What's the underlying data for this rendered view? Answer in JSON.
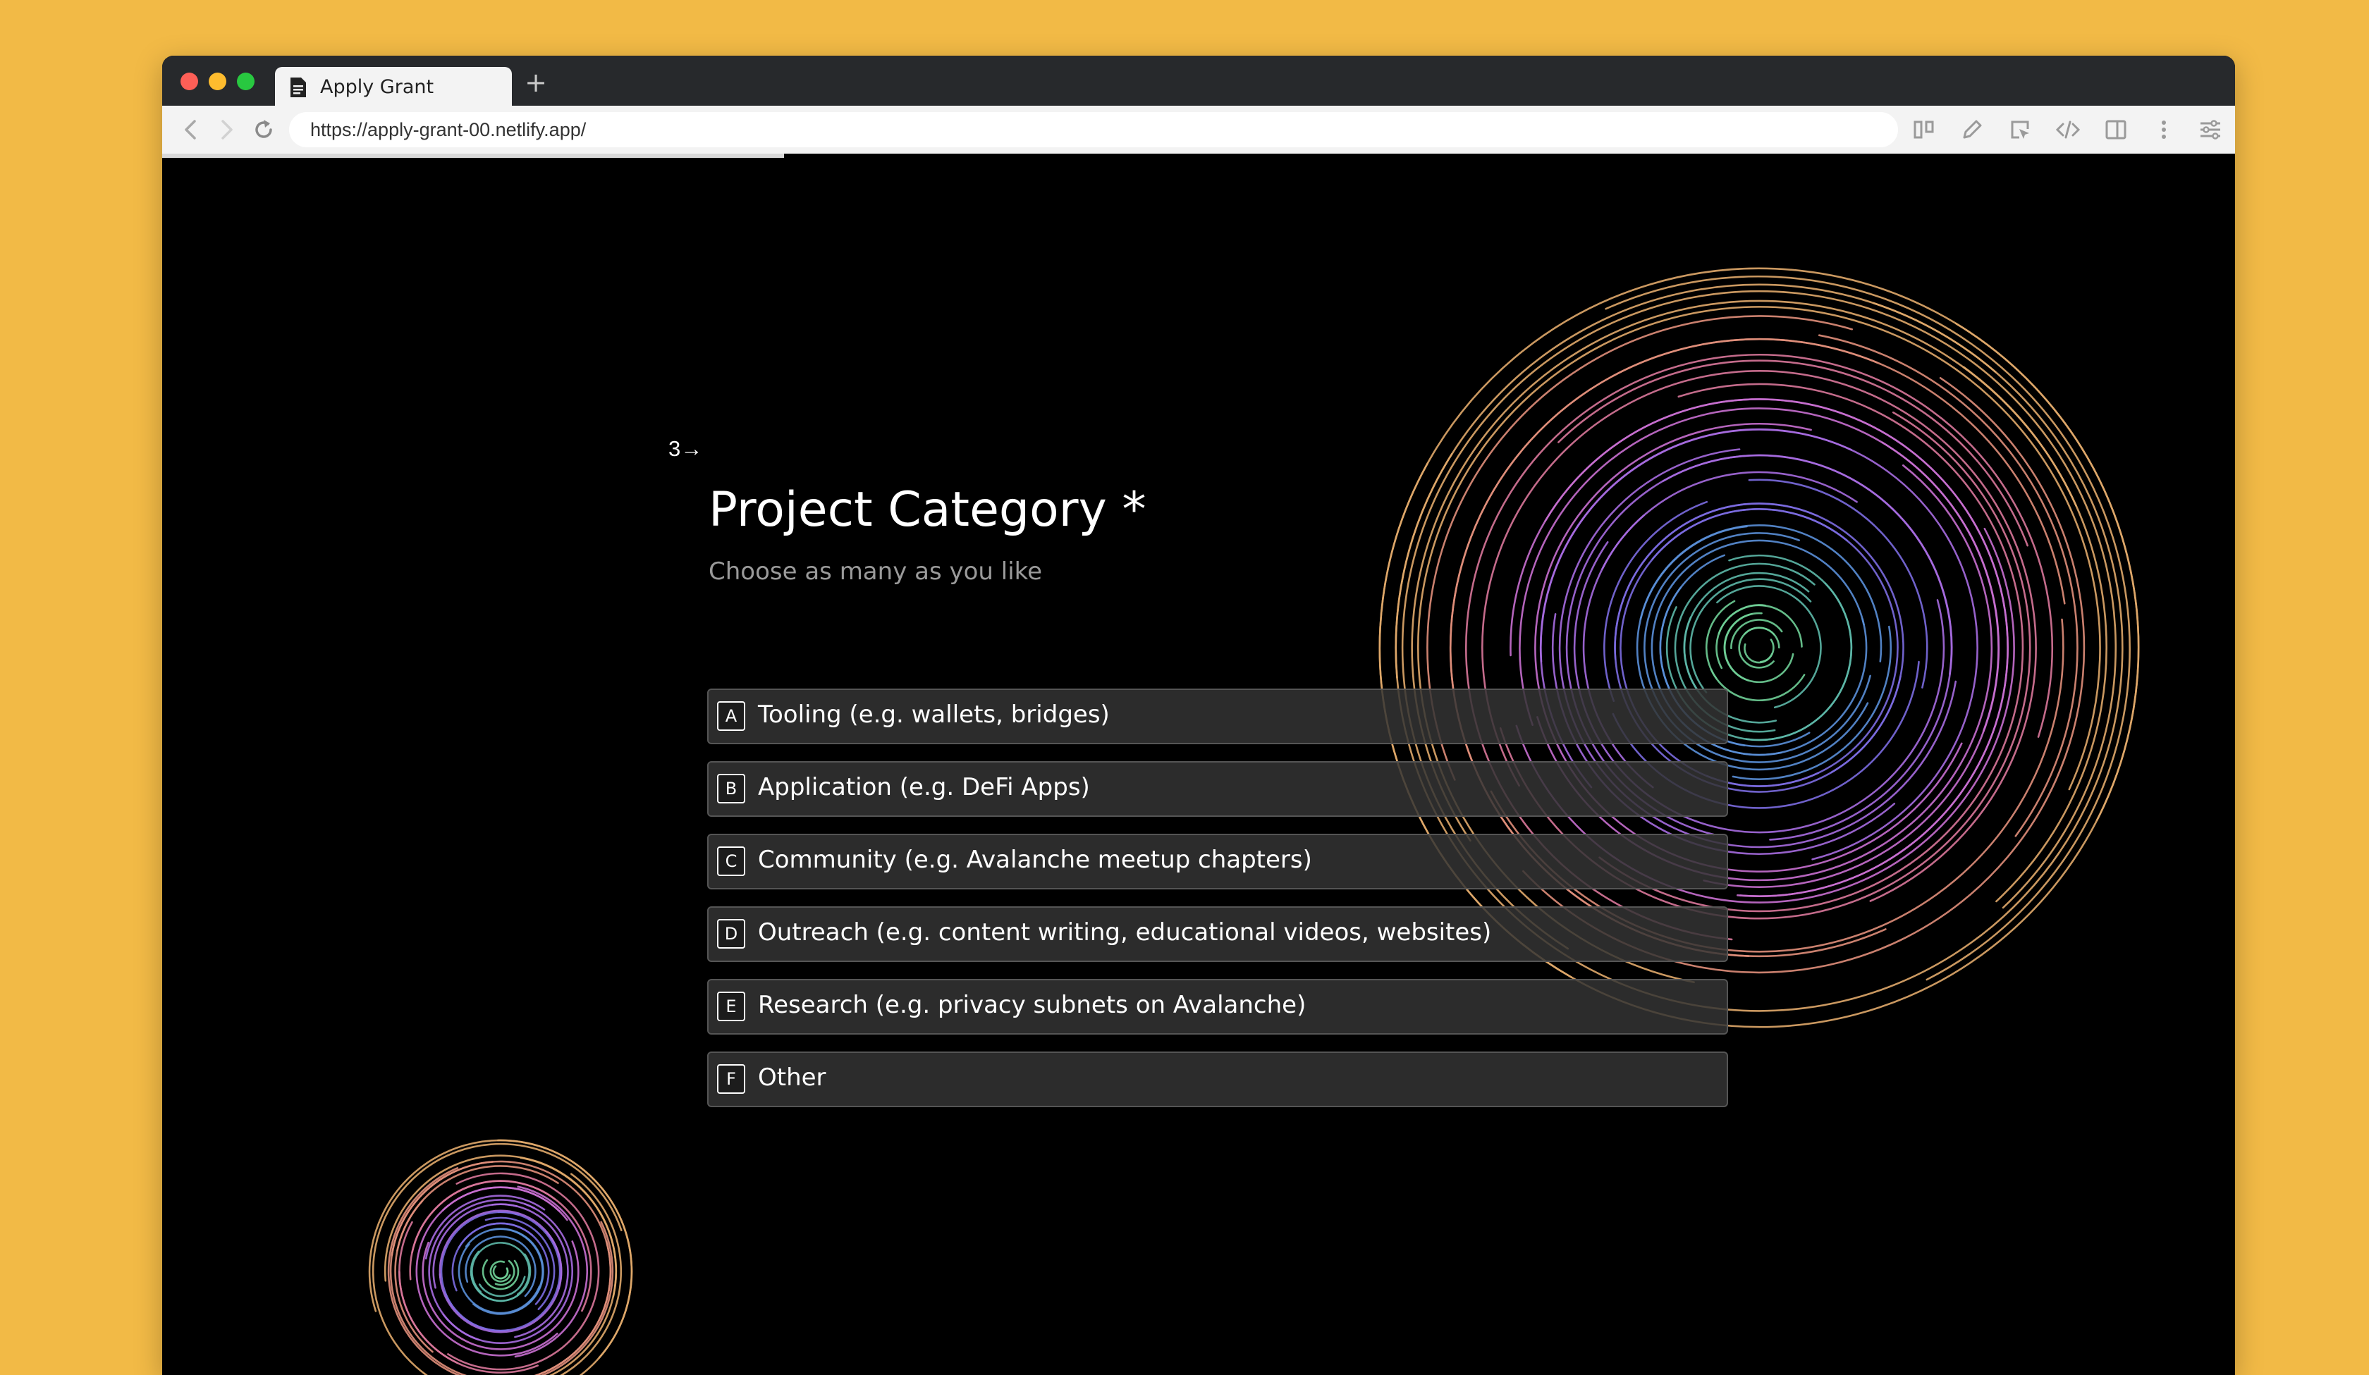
{
  "browser": {
    "tab_title": "Apply Grant",
    "new_tab_label": "+",
    "url": "https://apply-grant-00.netlify.app/"
  },
  "form": {
    "progress": 0.3,
    "question_number": "3",
    "question_arrow": "→",
    "title": "Project Category *",
    "subtitle": "Choose as many as you like",
    "choices": [
      {
        "key": "A",
        "label": "Tooling (e.g. wallets, bridges)"
      },
      {
        "key": "B",
        "label": "Application (e.g. DeFi Apps)"
      },
      {
        "key": "C",
        "label": "Community (e.g. Avalanche meetup chapters)"
      },
      {
        "key": "D",
        "label": "Outreach (e.g. content writing, educational videos, websites)"
      },
      {
        "key": "E",
        "label": "Research (e.g. privacy subnets on Avalanche)"
      },
      {
        "key": "F",
        "label": "Other"
      }
    ]
  },
  "icons": {
    "back": "back-arrow-icon",
    "forward": "forward-arrow-icon",
    "reload": "reload-icon",
    "nav_up": "chevron-double-up-icon",
    "nav_down": "chevron-double-down-icon"
  }
}
